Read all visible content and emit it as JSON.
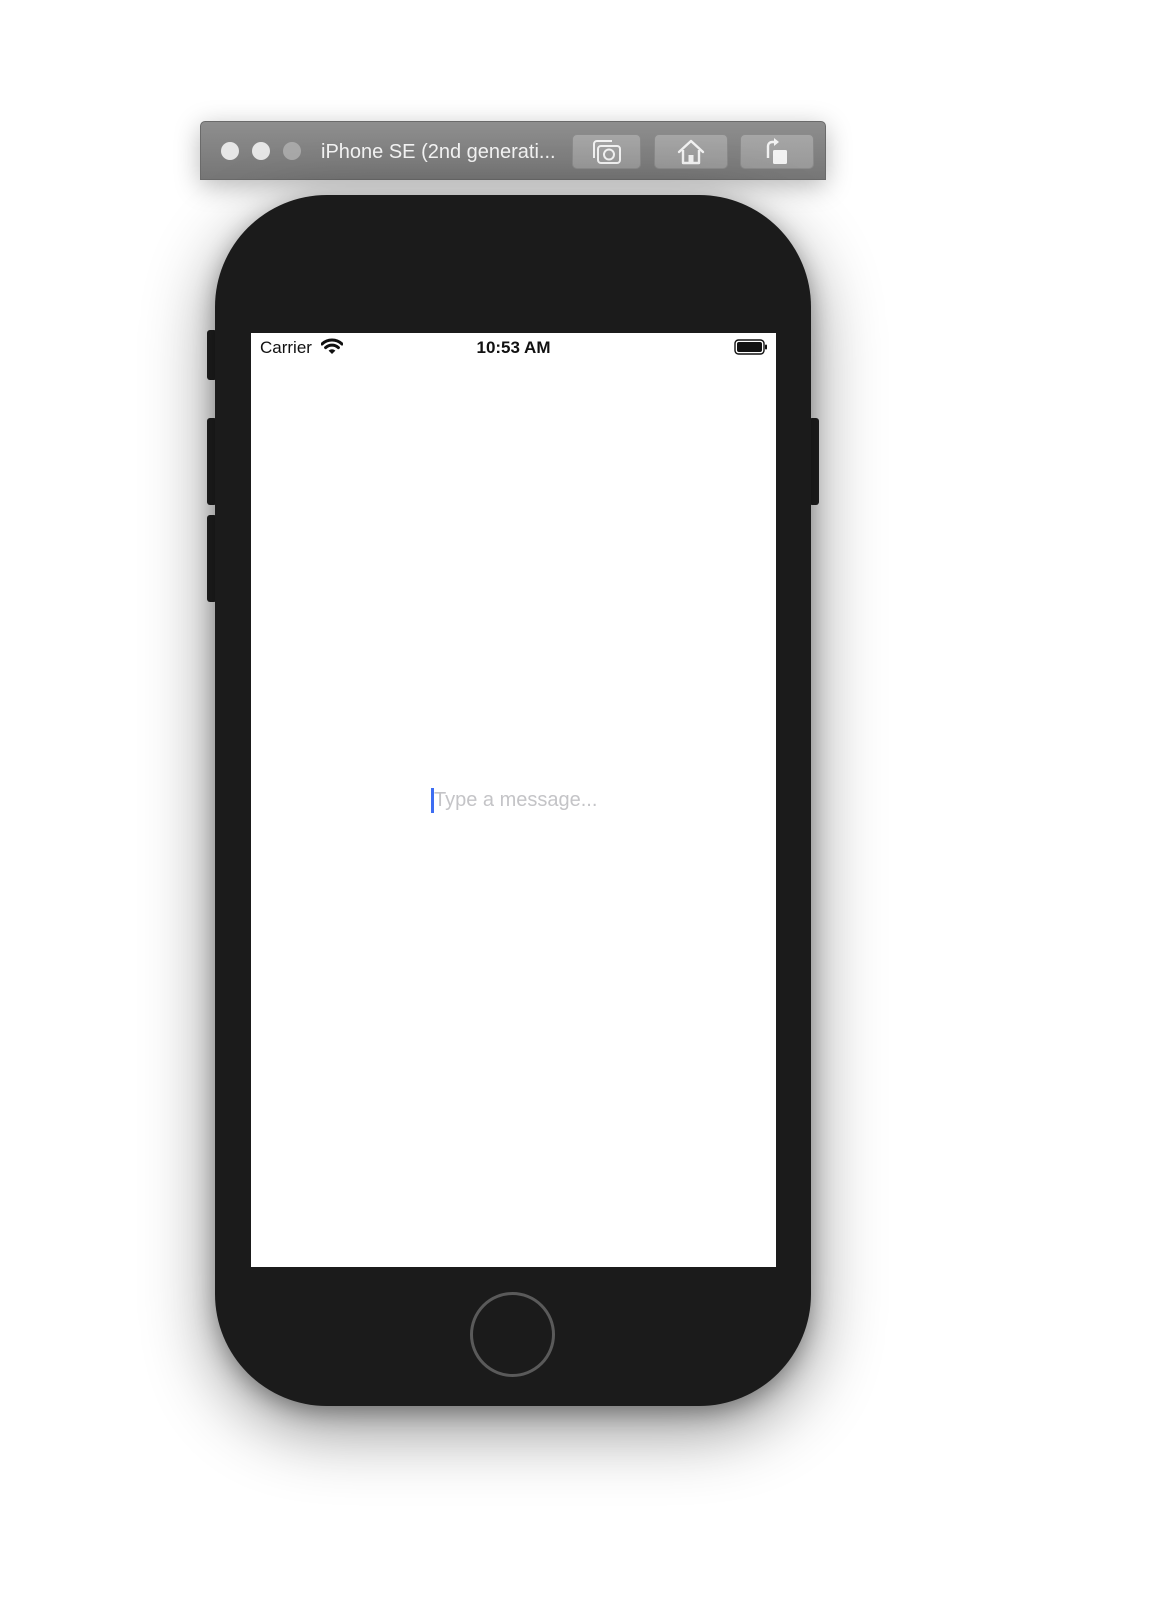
{
  "window": {
    "title": "iPhone SE (2nd generati...",
    "controls": {
      "close_icon": "close-traffic-light",
      "minimize_icon": "minimize-traffic-light",
      "zoom_icon": "zoom-traffic-light"
    },
    "toolbar": {
      "screenshot_icon": "camera-icon",
      "home_icon": "house-icon",
      "rotate_icon": "rotate-icon"
    }
  },
  "status_bar": {
    "carrier": "Carrier",
    "time": "10:53 AM",
    "wifi_icon": "wifi-icon",
    "battery_icon": "battery-full-icon"
  },
  "composer": {
    "placeholder": "Type a message...",
    "value": ""
  },
  "colors": {
    "caret": "#3d6df2",
    "placeholder": "#c4c4c7",
    "device_body": "#1b1b1b"
  }
}
